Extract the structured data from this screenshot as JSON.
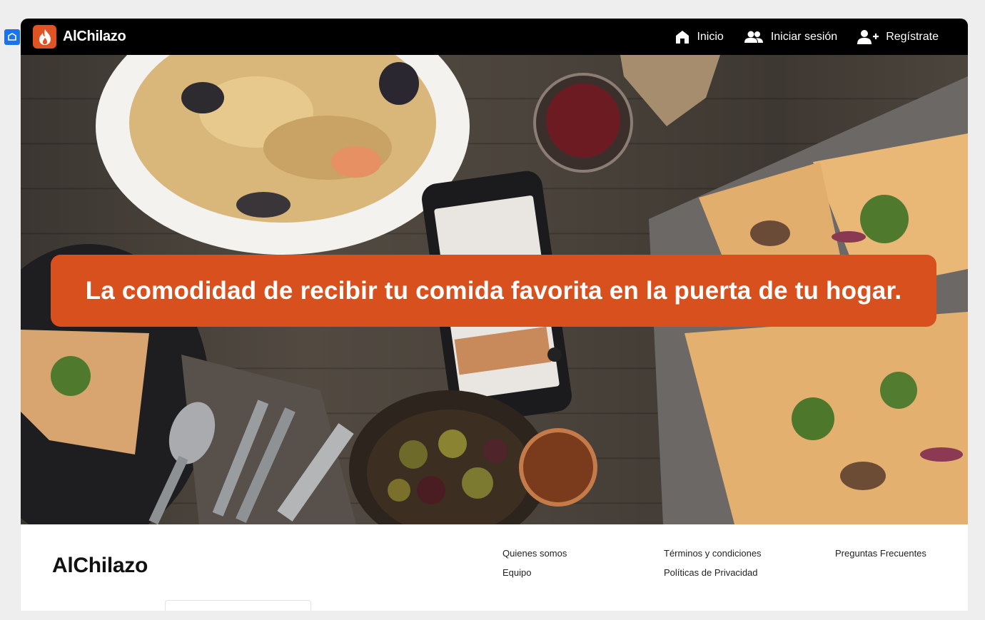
{
  "app": {
    "brand_name": "AlChilazo",
    "brand_color": "#e05322"
  },
  "nav": {
    "items": [
      {
        "label": "Inicio",
        "icon": "home-icon"
      },
      {
        "label": "Iniciar sesión",
        "icon": "users-icon"
      },
      {
        "label": "Regístrate",
        "icon": "add-user-icon"
      }
    ]
  },
  "hero": {
    "headline": "La comodidad de recibir tu comida favorita en la puerta de tu hogar.",
    "banner_color": "#d9501f"
  },
  "footer": {
    "brand": "AlChilazo",
    "columns": [
      {
        "links": [
          "Quienes somos",
          "Equipo"
        ]
      },
      {
        "links": [
          "Términos y condiciones",
          "Políticas de Privacidad"
        ]
      },
      {
        "links": [
          "Preguntas Frecuentes"
        ]
      }
    ]
  }
}
